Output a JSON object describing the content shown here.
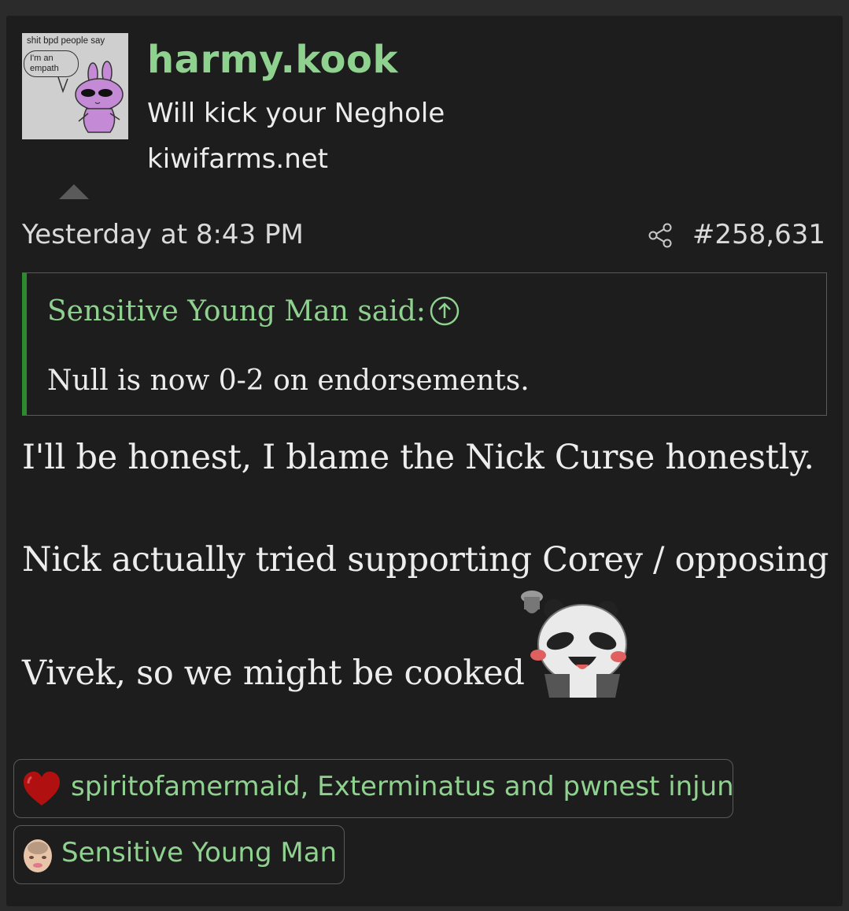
{
  "user": {
    "name": "harmy.kook",
    "title": "Will kick your Neghole",
    "site": "kiwifarms.net",
    "avatar_caption": "shit bpd people say",
    "avatar_bubble_line1": "I'm an",
    "avatar_bubble_line2": "empath"
  },
  "meta": {
    "date": "Yesterday at 8:43 PM",
    "post_number": "#258,631"
  },
  "quote": {
    "attribution": "Sensitive Young Man said:",
    "text": "Null is now 0-2 on endorsements."
  },
  "body": {
    "line1": "I'll be honest, I blame the Nick Curse honestly.",
    "line2": "Nick actually tried supporting Corey / opposing",
    "line3": "Vivek, so we might be cooked"
  },
  "reactions": [
    {
      "icon": "heart-icon",
      "text": "spiritofamermaid, Exterminatus and pwnest injun"
    },
    {
      "icon": "face-icon",
      "text": "Sensitive Young Man"
    }
  ],
  "colors": {
    "accent_green": "#8fd18f",
    "quote_bar_green": "#2d8b2d",
    "background": "#1d1d1d",
    "heart_red": "#b11010"
  }
}
